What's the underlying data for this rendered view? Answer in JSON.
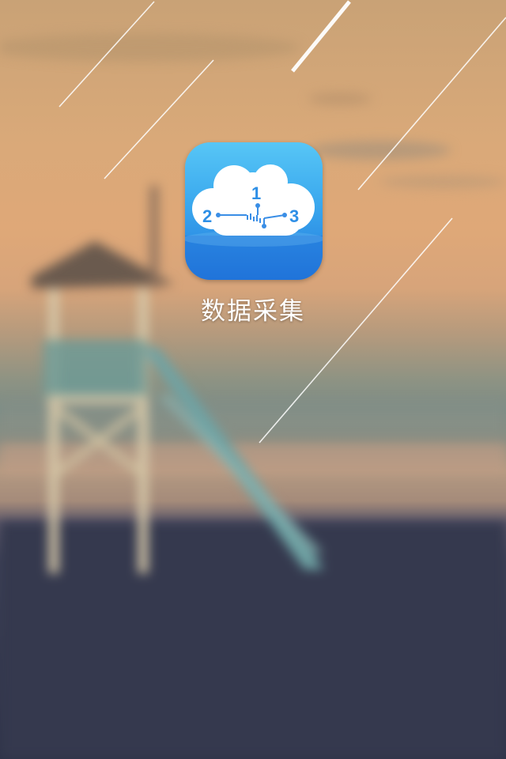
{
  "home_screen": {
    "apps": [
      {
        "label": "数据采集",
        "icon": "cloud-data-icon",
        "icon_digits": [
          "1",
          "2",
          "3"
        ]
      }
    ]
  },
  "colors": {
    "icon_top": "#57c6f6",
    "icon_bottom": "#2278dc",
    "cloud": "#ffffff",
    "digit_color": "#2e8fe6"
  }
}
